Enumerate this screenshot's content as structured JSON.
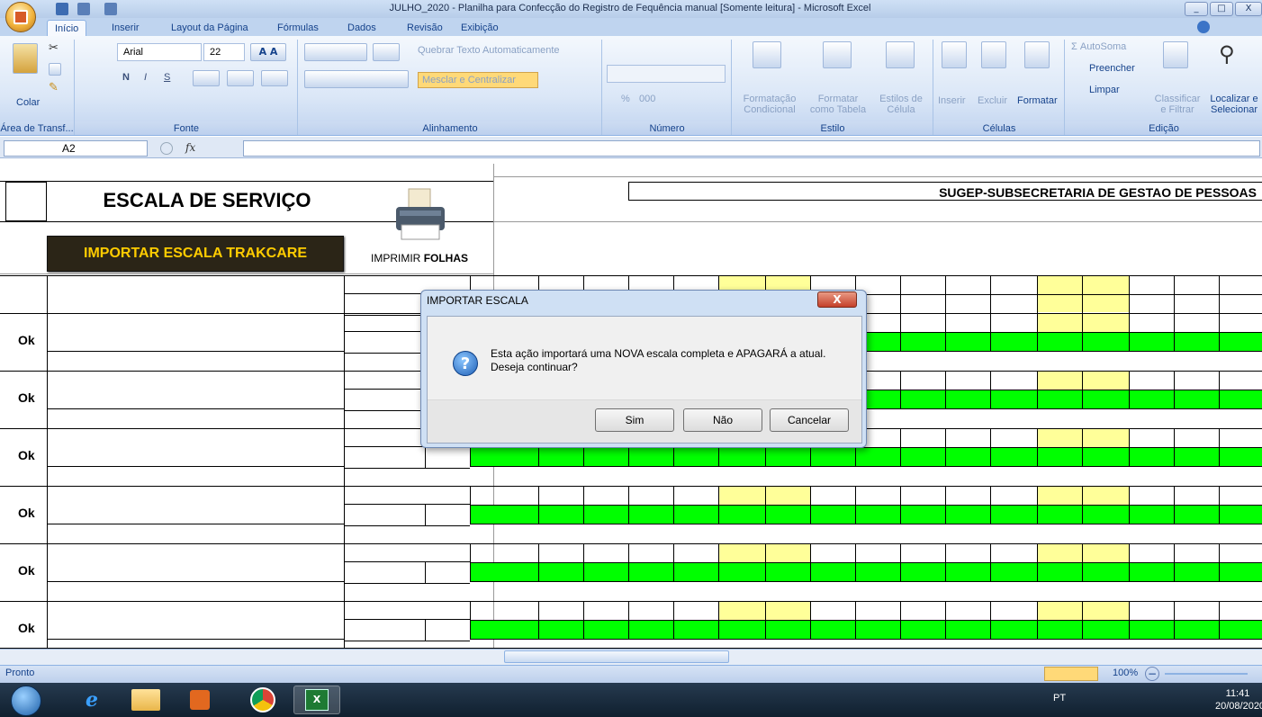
{
  "window": {
    "title": "JULHO_2020 - Planilha para Confecção do Registro de Fequência manual [Somente leitura] - Microsoft Excel"
  },
  "tabs": [
    "Início",
    "Inserir",
    "Layout da Página",
    "Fórmulas",
    "Dados",
    "Revisão",
    "Exibição"
  ],
  "ribbon": {
    "clipboard": {
      "paste": "Colar",
      "label": "Área de Transf..."
    },
    "font": {
      "name": "Arial",
      "size": "22",
      "bold": "N",
      "italic": "I",
      "underline": "S",
      "label": "Fonte"
    },
    "alignment": {
      "wrap": "Quebrar Texto Automaticamente",
      "merge": "Mesclar e Centralizar",
      "label": "Alinhamento"
    },
    "number": {
      "percent": "%",
      "thousands": "000",
      "label": "Número"
    },
    "styles": {
      "conditional": "Formatação Condicional",
      "table": "Formatar como Tabela",
      "cell": "Estilos de Célula",
      "label": "Estilo"
    },
    "cells": {
      "insert": "Inserir",
      "delete": "Excluir",
      "format": "Formatar",
      "label": "Células"
    },
    "editing": {
      "autosum": "Σ AutoSoma",
      "fill": "Preencher",
      "clear": "Limpar",
      "sort": "Classificar e Filtrar",
      "find": "Localizar e Selecionar",
      "label": "Edição"
    }
  },
  "formula": {
    "namebox": "A2",
    "fx": "fx"
  },
  "sheet": {
    "title": "ESCALA DE SERVIÇO",
    "org": "SUGEP-SUBSECRETARIA DE GESTAO DE PESSOAS",
    "import_button": "IMPORTAR ESCALA TRAKCARE",
    "print_label_1": "IMPRIMIR",
    "print_label_2": "FOLHAS",
    "ok_labels": [
      "Ok",
      "Ok",
      "Ok",
      "Ok",
      "Ok",
      "Ok"
    ]
  },
  "dialog": {
    "title": "IMPORTAR ESCALA",
    "close": "X",
    "message_1": "Esta ação importará uma NOVA escala completa e APAGARÁ a atual.",
    "message_2": "Deseja continuar?",
    "buttons": {
      "yes": "Sim",
      "no": "Não",
      "cancel": "Cancelar"
    }
  },
  "status": {
    "ready": "Pronto",
    "zoom": "100%"
  },
  "taskbar": {
    "lang": "PT",
    "time": "11:41",
    "date": "20/08/2020"
  },
  "colors": {
    "green": "#00ff00",
    "yellow": "#ffff99",
    "button_dark": "#2b2517",
    "button_text": "#ffcc00"
  }
}
